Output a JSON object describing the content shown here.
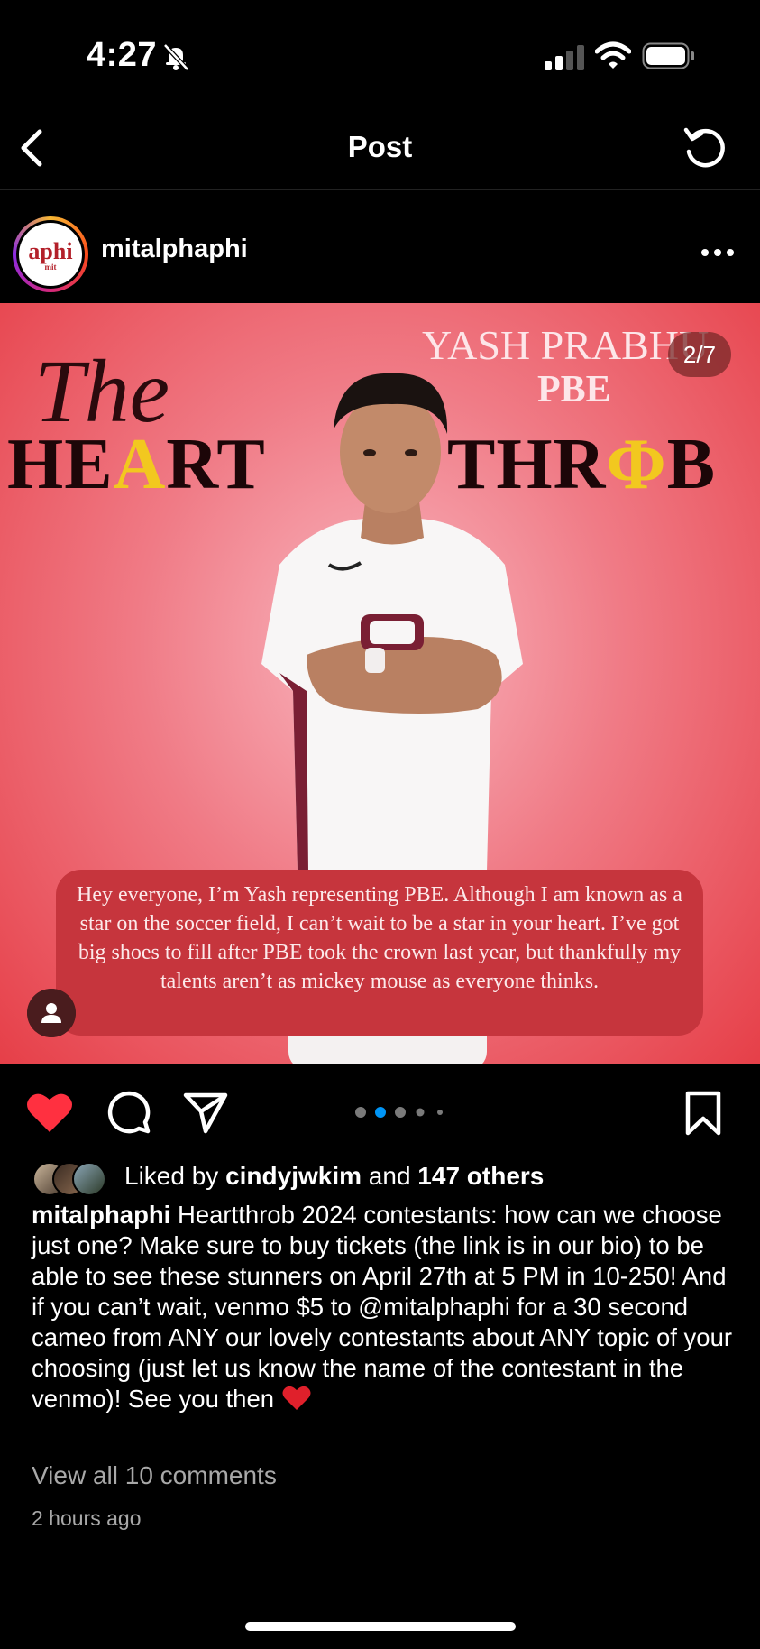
{
  "status": {
    "time": "4:27"
  },
  "nav": {
    "title": "Post"
  },
  "post": {
    "username": "mitalphaphi",
    "avatar_text": "aphi",
    "avatar_sub": "mit",
    "image": {
      "title_the": "The",
      "title_heart_parts": [
        "HE",
        "A",
        "RT"
      ],
      "title_throb_parts": [
        "THR",
        "Φ",
        "B"
      ],
      "contestant_name": "YASH PRABHU",
      "contestant_org": "PBE",
      "counter": "2/7",
      "bubble_text": "Hey everyone, I’m Yash representing PBE. Although I am known as a star on the soccer field, I can’t wait to be a star in your heart. I’ve got big shoes to fill after PBE took the crown last year, but thankfully my talents aren’t as mickey mouse as everyone thinks."
    },
    "carousel": {
      "count": 5,
      "active": 1
    },
    "likes": {
      "prefix": "Liked by",
      "user": "cindyjwkim",
      "middle": "and",
      "others": "147 others"
    },
    "caption": {
      "username": "mitalphaphi",
      "text": "Heartthrob 2024 contestants: how can we choose just one? Make sure to buy tickets (the link is in our bio) to be able to see these stunners on April 27th at 5 PM in 10-250! And if you can’t wait, venmo $5 to @mitalphaphi for a 30 second cameo from ANY our lovely contestants about ANY topic of your choosing (just let us know the name of the contestant in the venmo)! See you then",
      "emoji": "heart"
    },
    "view_comments": "View all 10 comments",
    "time_ago": "2 hours ago"
  },
  "colors": {
    "like_red": "#ff3040",
    "accent_blue": "#0095f6",
    "gold": "#f2c81f"
  },
  "icons": [
    "bell-slash-icon",
    "signal-icon",
    "wifi-icon",
    "battery-icon",
    "back-icon",
    "refresh-icon",
    "more-icon",
    "heart-icon",
    "comment-icon",
    "share-icon",
    "bookmark-icon",
    "user-tag-icon"
  ]
}
